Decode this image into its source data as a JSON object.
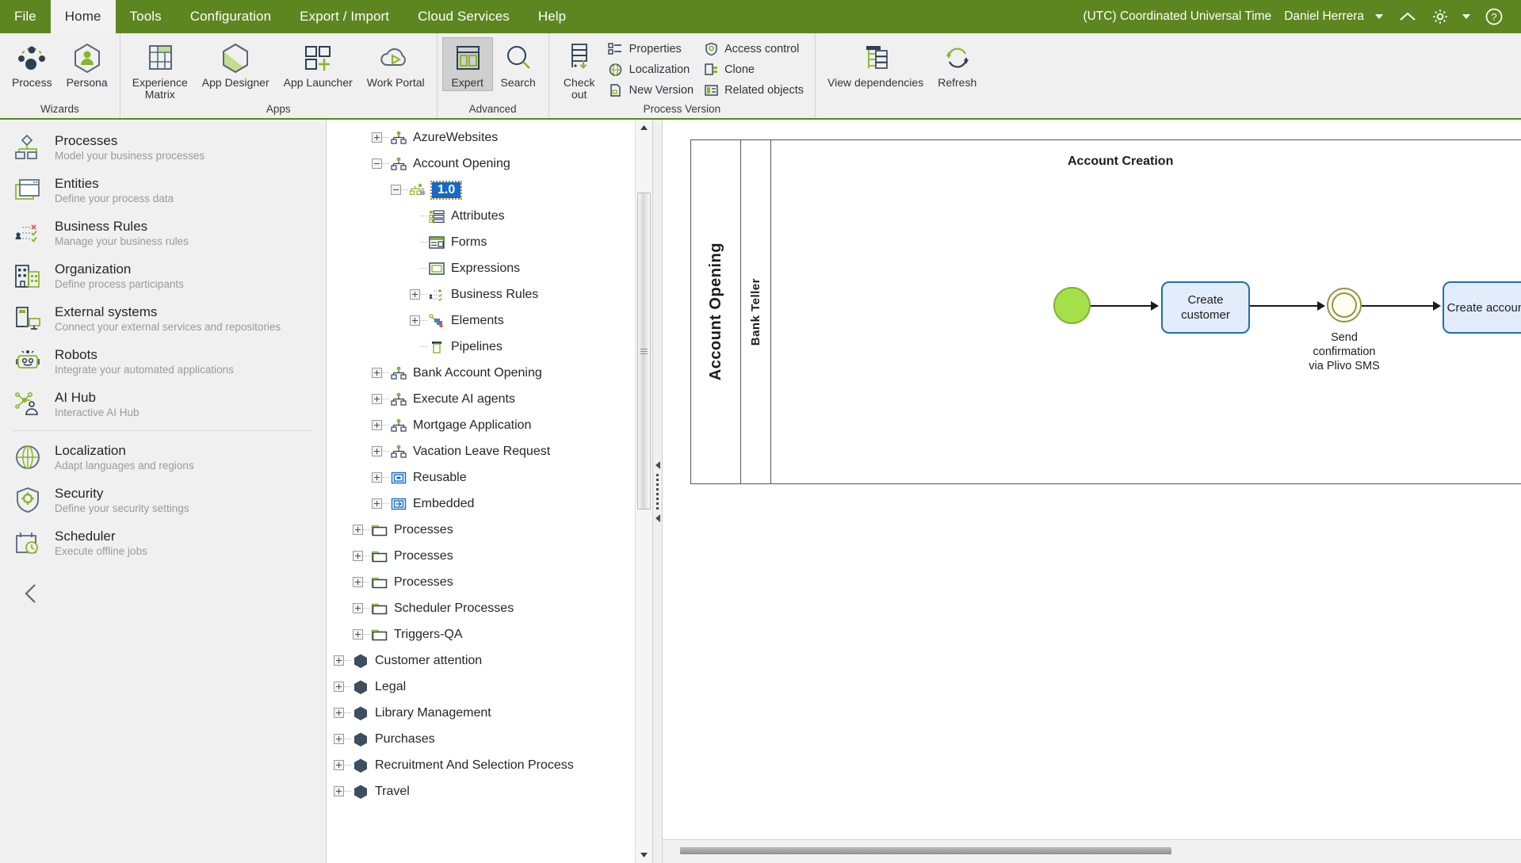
{
  "menubar": {
    "items": [
      {
        "label": "File",
        "active": false
      },
      {
        "label": "Home",
        "active": true
      },
      {
        "label": "Tools",
        "active": false
      },
      {
        "label": "Configuration",
        "active": false
      },
      {
        "label": "Export / Import",
        "active": false
      },
      {
        "label": "Cloud Services",
        "active": false
      },
      {
        "label": "Help",
        "active": false
      }
    ],
    "timezone": "(UTC) Coordinated Universal Time",
    "user": "Daniel Herrera",
    "collapse_icon": "chevron-up-icon",
    "settings_icon": "gear-icon",
    "help_icon": "question-circle-icon"
  },
  "ribbon": {
    "groups": [
      {
        "title": "Wizards",
        "buttons": [
          {
            "label": "Process",
            "icon": "process-nodes-icon",
            "selected": false
          },
          {
            "label": "Persona",
            "icon": "persona-hexagon-icon",
            "selected": false
          }
        ]
      },
      {
        "title": "Apps",
        "buttons": [
          {
            "label": "Experience\nMatrix",
            "icon": "experience-matrix-icon",
            "selected": false
          },
          {
            "label": "App Designer",
            "icon": "app-designer-hexagon-icon",
            "selected": false
          },
          {
            "label": "App Launcher",
            "icon": "app-launcher-grid-icon",
            "selected": false
          },
          {
            "label": "Work Portal",
            "icon": "work-portal-cloud-icon",
            "selected": false
          }
        ]
      },
      {
        "title": "Advanced",
        "buttons": [
          {
            "label": "Expert",
            "icon": "expert-panels-icon",
            "selected": true
          },
          {
            "label": "Search",
            "icon": "search-magnifier-icon",
            "selected": false
          }
        ]
      },
      {
        "title": "Process Version",
        "buttons": [
          {
            "label": "Check\nout",
            "icon": "check-out-icon",
            "selected": false
          }
        ],
        "small_columns": [
          [
            {
              "label": "Properties",
              "icon": "properties-list-icon"
            },
            {
              "label": "Localization",
              "icon": "localization-globe-icon"
            },
            {
              "label": "New Version",
              "icon": "new-version-doc-icon"
            }
          ],
          [
            {
              "label": "Access control",
              "icon": "access-control-shield-icon"
            },
            {
              "label": "Clone",
              "icon": "clone-copy-icon"
            },
            {
              "label": "Related objects",
              "icon": "related-objects-icon"
            }
          ]
        ]
      },
      {
        "title": "",
        "buttons": [
          {
            "label": "View dependencies",
            "icon": "view-dependencies-tree-icon",
            "selected": false
          },
          {
            "label": "Refresh",
            "icon": "refresh-circular-arrow-icon",
            "selected": false
          }
        ]
      }
    ]
  },
  "sidebar": {
    "items": [
      {
        "title": "Processes",
        "subtitle": "Model your business processes",
        "icon": "processes-diagram-icon"
      },
      {
        "title": "Entities",
        "subtitle": "Define your process data",
        "icon": "entities-window-icon"
      },
      {
        "title": "Business Rules",
        "subtitle": "Manage your business rules",
        "icon": "business-rules-icon"
      },
      {
        "title": "Organization",
        "subtitle": "Define process participants",
        "icon": "organization-buildings-icon"
      },
      {
        "title": "External systems",
        "subtitle": "Connect your external services and repositories",
        "icon": "external-systems-icon"
      },
      {
        "title": "Robots",
        "subtitle": "Integrate your automated applications",
        "icon": "robot-icon"
      },
      {
        "title": "AI Hub",
        "subtitle": "Interactive AI Hub",
        "icon": "ai-hub-network-icon"
      },
      {
        "title": "Localization",
        "subtitle": "Adapt languages and regions",
        "icon": "localization-globe-icon"
      },
      {
        "title": "Security",
        "subtitle": "Define your security settings",
        "icon": "security-shield-gear-icon"
      },
      {
        "title": "Scheduler",
        "subtitle": "Execute offline jobs",
        "icon": "scheduler-calendar-clock-icon"
      }
    ],
    "divider_after_index": 6,
    "collapse_icon": "chevron-left-icon"
  },
  "tree": {
    "nodes": [
      {
        "label": "AzureWebsites",
        "depth": 3,
        "icon": "process-tree-icon",
        "expander": "plus",
        "selected": false
      },
      {
        "label": "Account Opening",
        "depth": 3,
        "icon": "process-tree-icon",
        "expander": "minus",
        "selected": false
      },
      {
        "label": "1.0",
        "depth": 4,
        "icon": "version-lock-icon",
        "expander": "minus",
        "selected": true
      },
      {
        "label": "Attributes",
        "depth": 5,
        "icon": "attributes-list-icon",
        "expander": "none",
        "selected": false
      },
      {
        "label": "Forms",
        "depth": 5,
        "icon": "forms-icon",
        "expander": "none",
        "selected": false
      },
      {
        "label": "Expressions",
        "depth": 5,
        "icon": "expressions-icon",
        "expander": "none",
        "selected": false
      },
      {
        "label": "Business Rules",
        "depth": 5,
        "icon": "business-rules-icon",
        "expander": "plus",
        "selected": false
      },
      {
        "label": "Elements",
        "depth": 5,
        "icon": "elements-icon",
        "expander": "plus",
        "selected": false
      },
      {
        "label": "Pipelines",
        "depth": 5,
        "icon": "pipelines-icon",
        "expander": "none",
        "selected": false
      },
      {
        "label": "Bank Account Opening",
        "depth": 3,
        "icon": "process-tree-icon",
        "expander": "plus",
        "selected": false
      },
      {
        "label": "Execute AI agents",
        "depth": 3,
        "icon": "process-tree-icon",
        "expander": "plus",
        "selected": false
      },
      {
        "label": "Mortgage Application",
        "depth": 3,
        "icon": "process-tree-icon",
        "expander": "plus",
        "selected": false
      },
      {
        "label": "Vacation Leave Request",
        "depth": 3,
        "icon": "process-tree-icon",
        "expander": "plus",
        "selected": false
      },
      {
        "label": "Reusable",
        "depth": 3,
        "icon": "reusable-icon",
        "expander": "plus",
        "selected": false
      },
      {
        "label": "Embedded",
        "depth": 3,
        "icon": "embedded-icon",
        "expander": "plus",
        "selected": false
      },
      {
        "label": "Processes",
        "depth": 2,
        "icon": "folder-icon",
        "expander": "plus",
        "selected": false
      },
      {
        "label": "Processes",
        "depth": 2,
        "icon": "folder-icon",
        "expander": "plus",
        "selected": false
      },
      {
        "label": "Processes",
        "depth": 2,
        "icon": "folder-icon",
        "expander": "plus",
        "selected": false
      },
      {
        "label": "Scheduler Processes",
        "depth": 2,
        "icon": "folder-icon",
        "expander": "plus",
        "selected": false
      },
      {
        "label": "Triggers-QA",
        "depth": 2,
        "icon": "folder-icon",
        "expander": "plus",
        "selected": false
      },
      {
        "label": "Customer attention",
        "depth": 1,
        "icon": "module-hexagon-icon",
        "expander": "plus",
        "selected": false
      },
      {
        "label": "Legal",
        "depth": 1,
        "icon": "module-hexagon-icon",
        "expander": "plus",
        "selected": false
      },
      {
        "label": "Library Management",
        "depth": 1,
        "icon": "module-hexagon-icon",
        "expander": "plus",
        "selected": false
      },
      {
        "label": "Purchases",
        "depth": 1,
        "icon": "module-hexagon-icon",
        "expander": "plus",
        "selected": false
      },
      {
        "label": "Recruitment And Selection Process",
        "depth": 1,
        "icon": "module-hexagon-icon",
        "expander": "plus",
        "selected": false
      },
      {
        "label": "Travel",
        "depth": 1,
        "icon": "module-hexagon-icon",
        "expander": "plus",
        "selected": false
      }
    ]
  },
  "diagram": {
    "pool_name": "Account Opening",
    "lane_name": "Bank Teller",
    "lane_title": "Account Creation",
    "nodes": [
      {
        "type": "start-event",
        "label": ""
      },
      {
        "type": "task",
        "label": "Create\ncustomer"
      },
      {
        "type": "intermediate-event",
        "label": "Send\nconfirmation\nvia Plivo SMS"
      },
      {
        "type": "task",
        "label": "Create account"
      }
    ]
  },
  "colors": {
    "brand_green": "#5d8520",
    "accent_green": "#8ab42a",
    "task_fill": "#e3ecfb",
    "task_border": "#1f6fb0",
    "start_fill": "#a5e04b",
    "selection_blue": "#1569c7"
  }
}
